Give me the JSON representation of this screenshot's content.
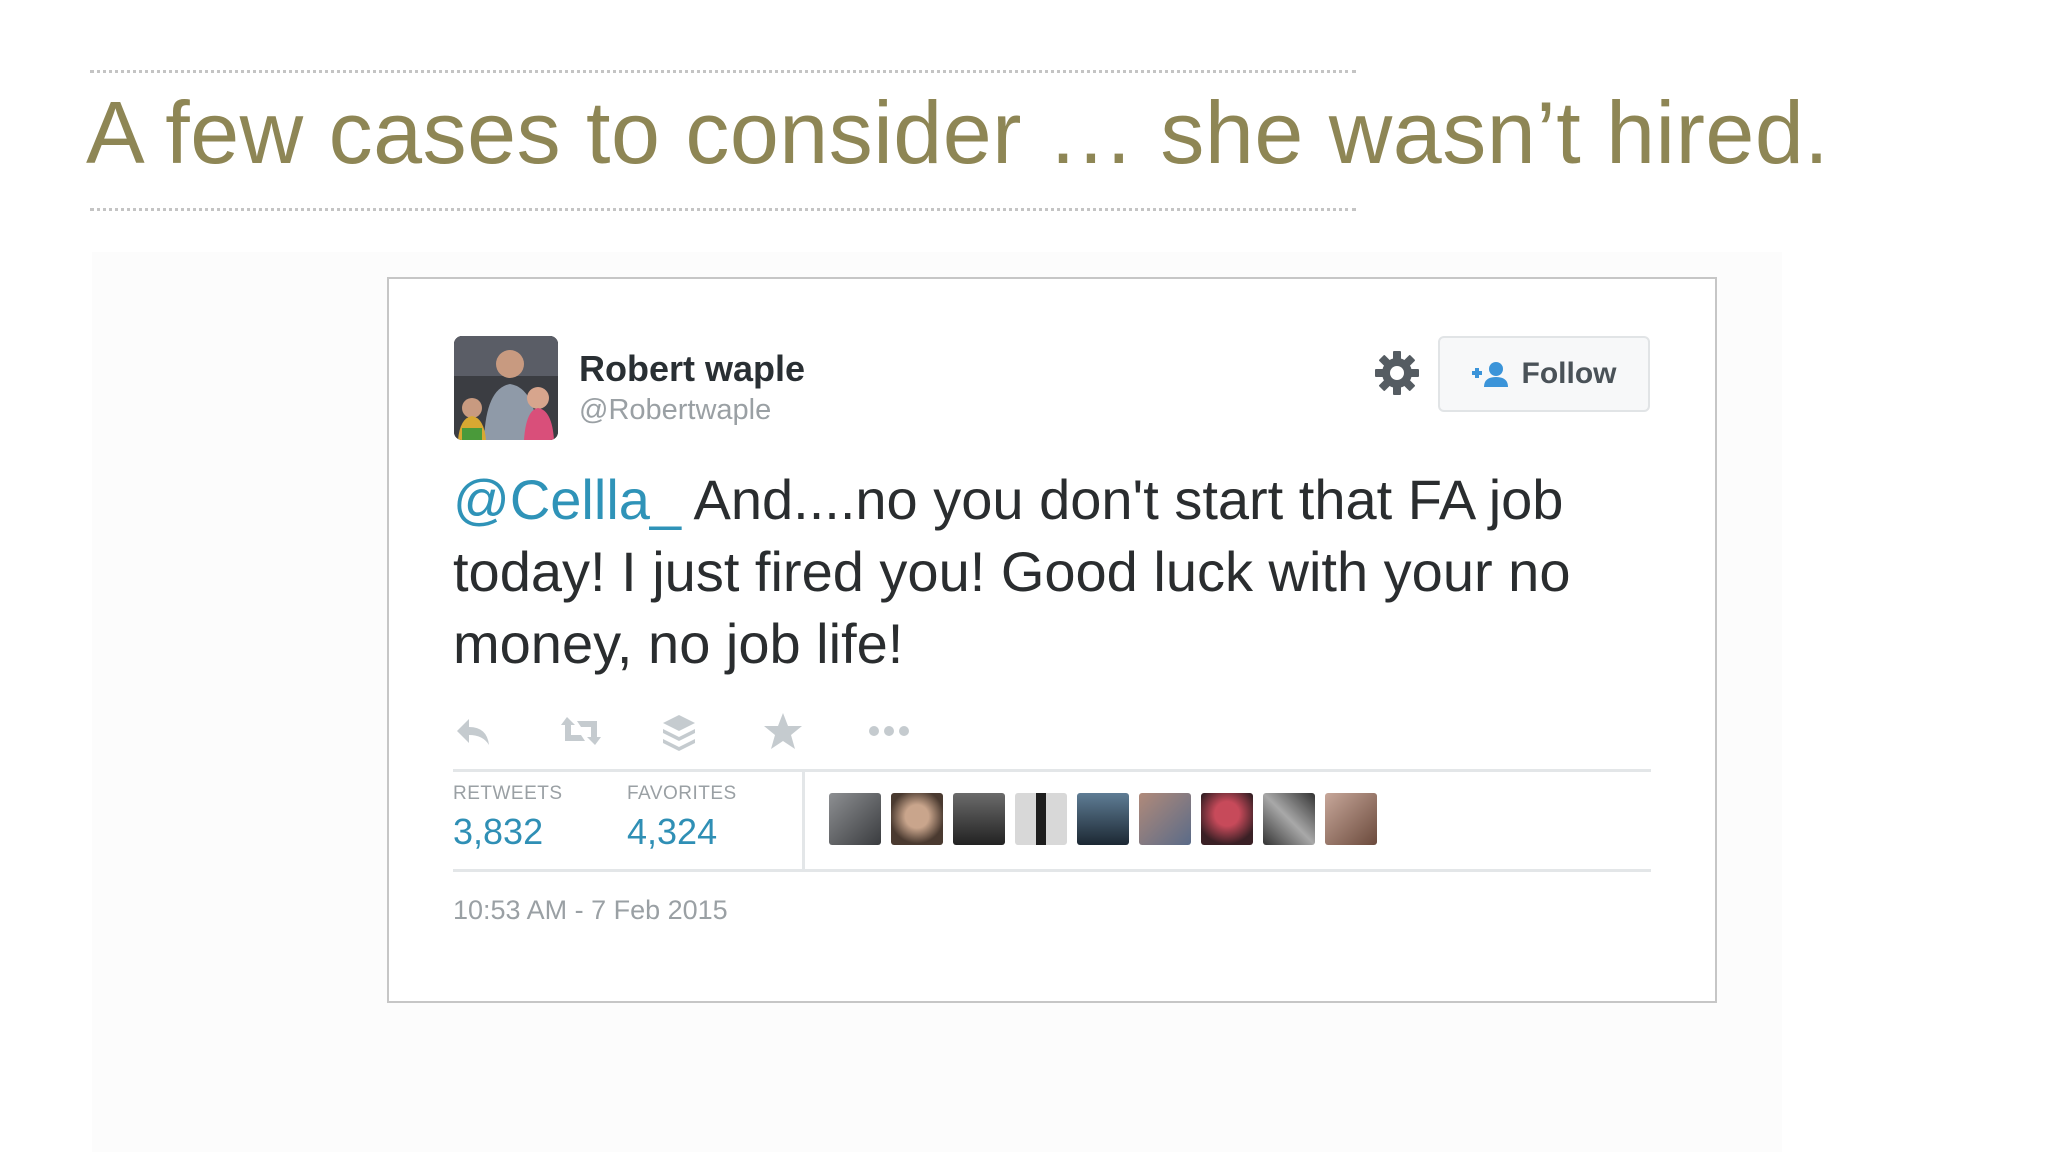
{
  "slide": {
    "title": "A few cases to consider … she wasn’t hired."
  },
  "tweet": {
    "author_name": "Robert waple",
    "author_handle": "@Robertwaple",
    "follow_label": "Follow",
    "mention": "@Cellla_",
    "body": " And....no you don't start that FA job today!  I just fired you!  Good luck with your no money, no job life!",
    "retweets_label": "RETWEETS",
    "retweets_count": "3,832",
    "favorites_label": "FAVORITES",
    "favorites_count": "4,324",
    "timestamp": "10:53 AM - 7 Feb 2015",
    "icons": [
      "reply-icon",
      "retweet-icon",
      "stack-icon",
      "favorite-icon",
      "more-icon",
      "gear-icon",
      "follow-person-icon"
    ],
    "favoriter_avatar_count": 9
  },
  "colors": {
    "title": "#8e8655",
    "mention": "#2f93b8",
    "stat_value": "#2f8fb5"
  }
}
